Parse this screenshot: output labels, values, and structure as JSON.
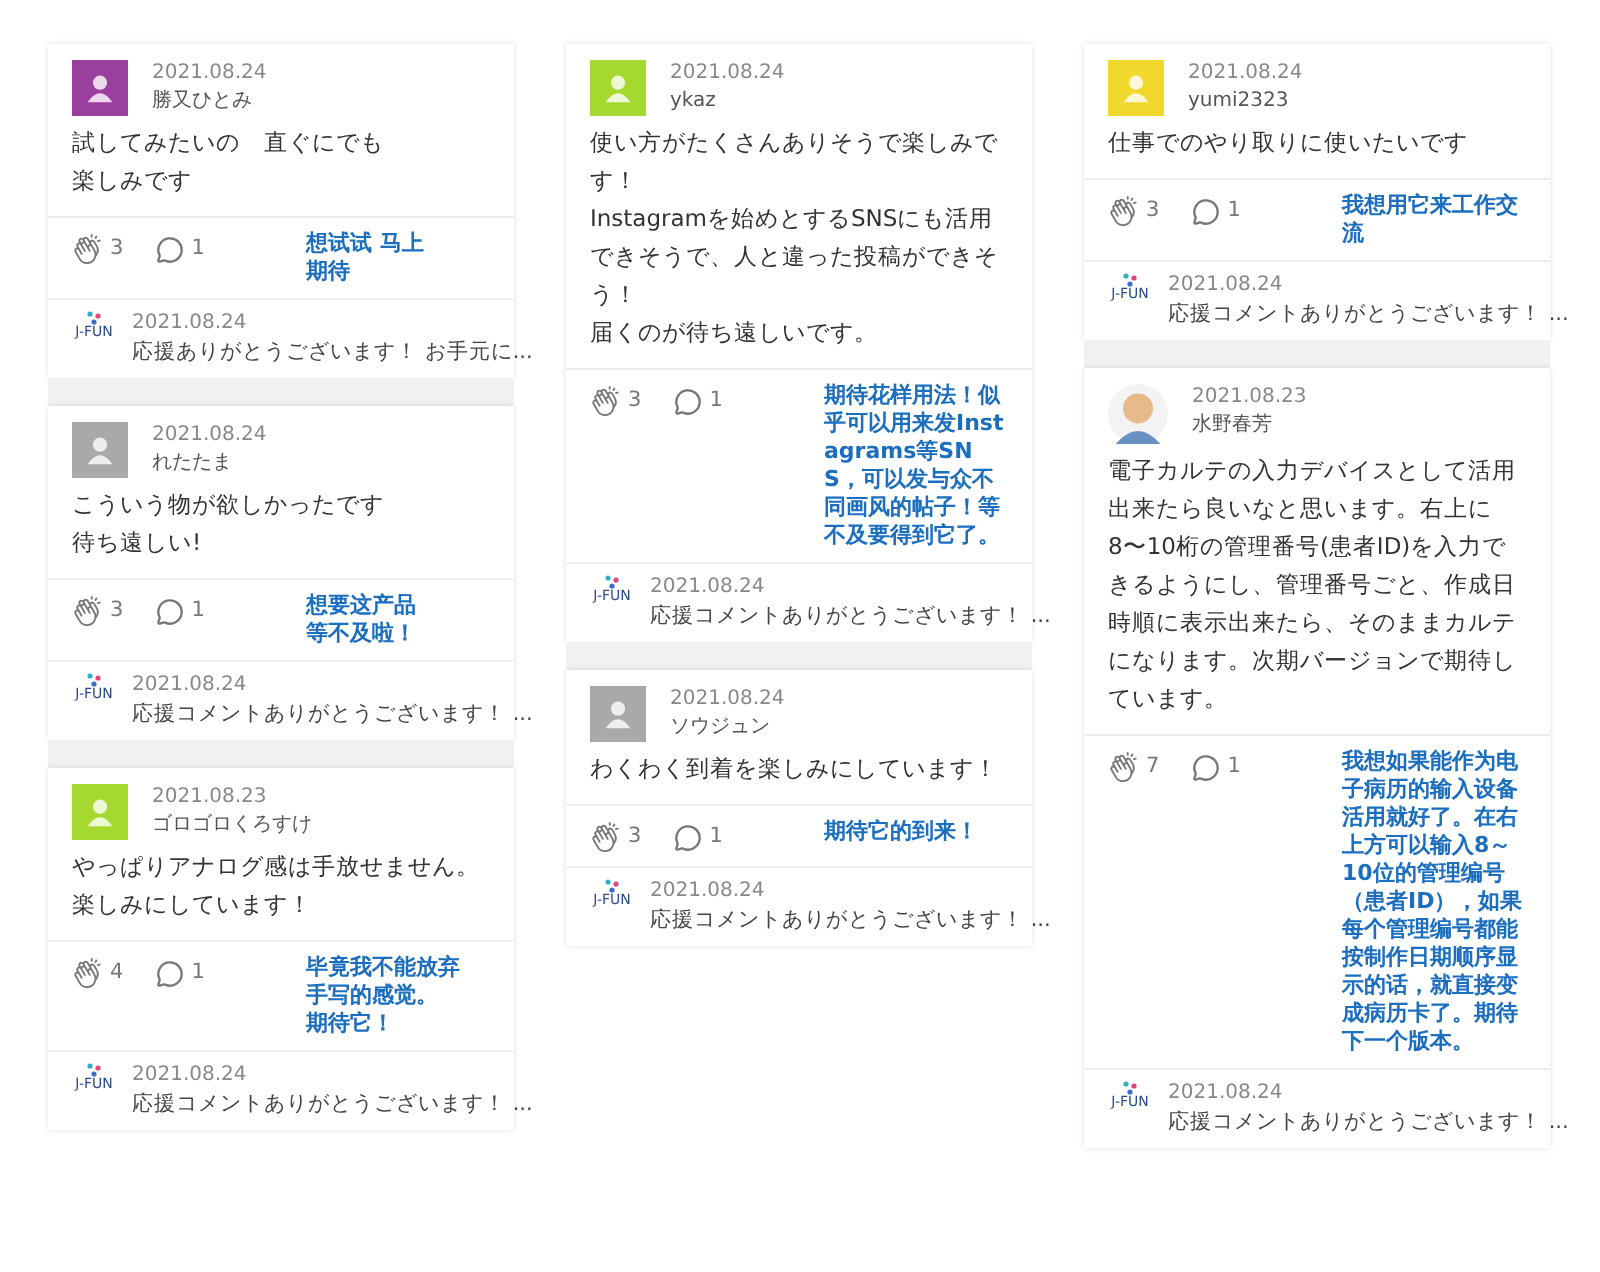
{
  "columns": [
    {
      "cards": [
        {
          "avatar": {
            "kind": "plain",
            "color": "#9b3f9e"
          },
          "date": "2021.08.24",
          "name": "勝又ひとみ",
          "body": [
            "試してみたいの　直ぐにでも",
            "楽しみです"
          ],
          "claps": "3",
          "comments": "1",
          "reply": {
            "logo_text": "J-FUN",
            "date": "2021.08.24",
            "text": "応援ありがとうございます！ お手元に..."
          },
          "note": [
            "想试试 马上",
            "期待"
          ]
        },
        {
          "avatar": {
            "kind": "plain",
            "color": "#a9a9a9"
          },
          "date": "2021.08.24",
          "name": "れたたま",
          "body": [
            "こういう物が欲しかったです",
            "待ち遠しい!"
          ],
          "claps": "3",
          "comments": "1",
          "reply": {
            "logo_text": "J-FUN",
            "date": "2021.08.24",
            "text": "応援コメントありがとうございます！ ..."
          },
          "note": [
            "想要这产品",
            "等不及啦！"
          ]
        },
        {
          "avatar": {
            "kind": "plain",
            "color": "#a6d930"
          },
          "date": "2021.08.23",
          "name": "ゴロゴロくろすけ",
          "body": [
            "やっぱりアナログ感は手放せません。",
            "楽しみにしています！"
          ],
          "claps": "4",
          "comments": "1",
          "reply": {
            "logo_text": "J-FUN",
            "date": "2021.08.24",
            "text": "応援コメントありがとうございます！ ..."
          },
          "note": [
            "毕竟我不能放弃",
            "手写的感觉。",
            "期待它！"
          ]
        }
      ]
    },
    {
      "cards": [
        {
          "avatar": {
            "kind": "plain",
            "color": "#a6d930"
          },
          "date": "2021.08.24",
          "name": "ykaz",
          "body": [
            "使い方がたくさんありそうで楽しみです！",
            "Instagramを始めとするSNSにも活用できそうで、人と違った投稿ができそう！",
            "届くのが待ち遠しいです。"
          ],
          "claps": "3",
          "comments": "1",
          "reply": {
            "logo_text": "J-FUN",
            "date": "2021.08.24",
            "text": "応援コメントありがとうございます！ ..."
          },
          "note": [
            "期待花样用法！似乎可以用来发Instagrams等SNS，可以发与众不同画风的帖子！等不及要得到它了。"
          ]
        },
        {
          "avatar": {
            "kind": "plain",
            "color": "#a9a9a9"
          },
          "date": "2021.08.24",
          "name": "ソウジュン",
          "body": [
            "わくわく到着を楽しみにしています！"
          ],
          "claps": "3",
          "comments": "1",
          "reply": {
            "logo_text": "J-FUN",
            "date": "2021.08.24",
            "text": "応援コメントありがとうございます！ ..."
          },
          "note": [
            "期待它的到来！"
          ]
        }
      ]
    },
    {
      "cards": [
        {
          "avatar": {
            "kind": "plain",
            "color": "#f2d82c"
          },
          "date": "2021.08.24",
          "name": "yumi2323",
          "body": [
            "仕事でのやり取りに使いたいです"
          ],
          "claps": "3",
          "comments": "1",
          "reply": {
            "logo_text": "J-FUN",
            "date": "2021.08.24",
            "text": "応援コメントありがとうございます！ ..."
          },
          "note": [
            "我想用它来工作交流"
          ]
        },
        {
          "avatar": {
            "kind": "illustration",
            "color": "#e8b98a"
          },
          "date": "2021.08.23",
          "name": "水野春芳",
          "body": [
            "電子カルテの入力デバイスとして活用出来たら良いなと思います。右上に8〜10桁の管理番号(患者ID)を入力できるようにし、管理番号ごと、作成日時順に表示出来たら、そのままカルテになります。次期バージョンで期待しています。"
          ],
          "claps": "7",
          "comments": "1",
          "reply": {
            "logo_text": "J-FUN",
            "date": "2021.08.24",
            "text": "応援コメントありがとうございます！ ..."
          },
          "note": [
            "我想如果能作为电子病历的输入设备活用就好了。在右上方可以输入8～10位的管理编号（患者ID），如果每个管理编号都能按制作日期顺序显示的话，就直接变成病历卡了。期待下一个版本。"
          ]
        }
      ]
    }
  ]
}
